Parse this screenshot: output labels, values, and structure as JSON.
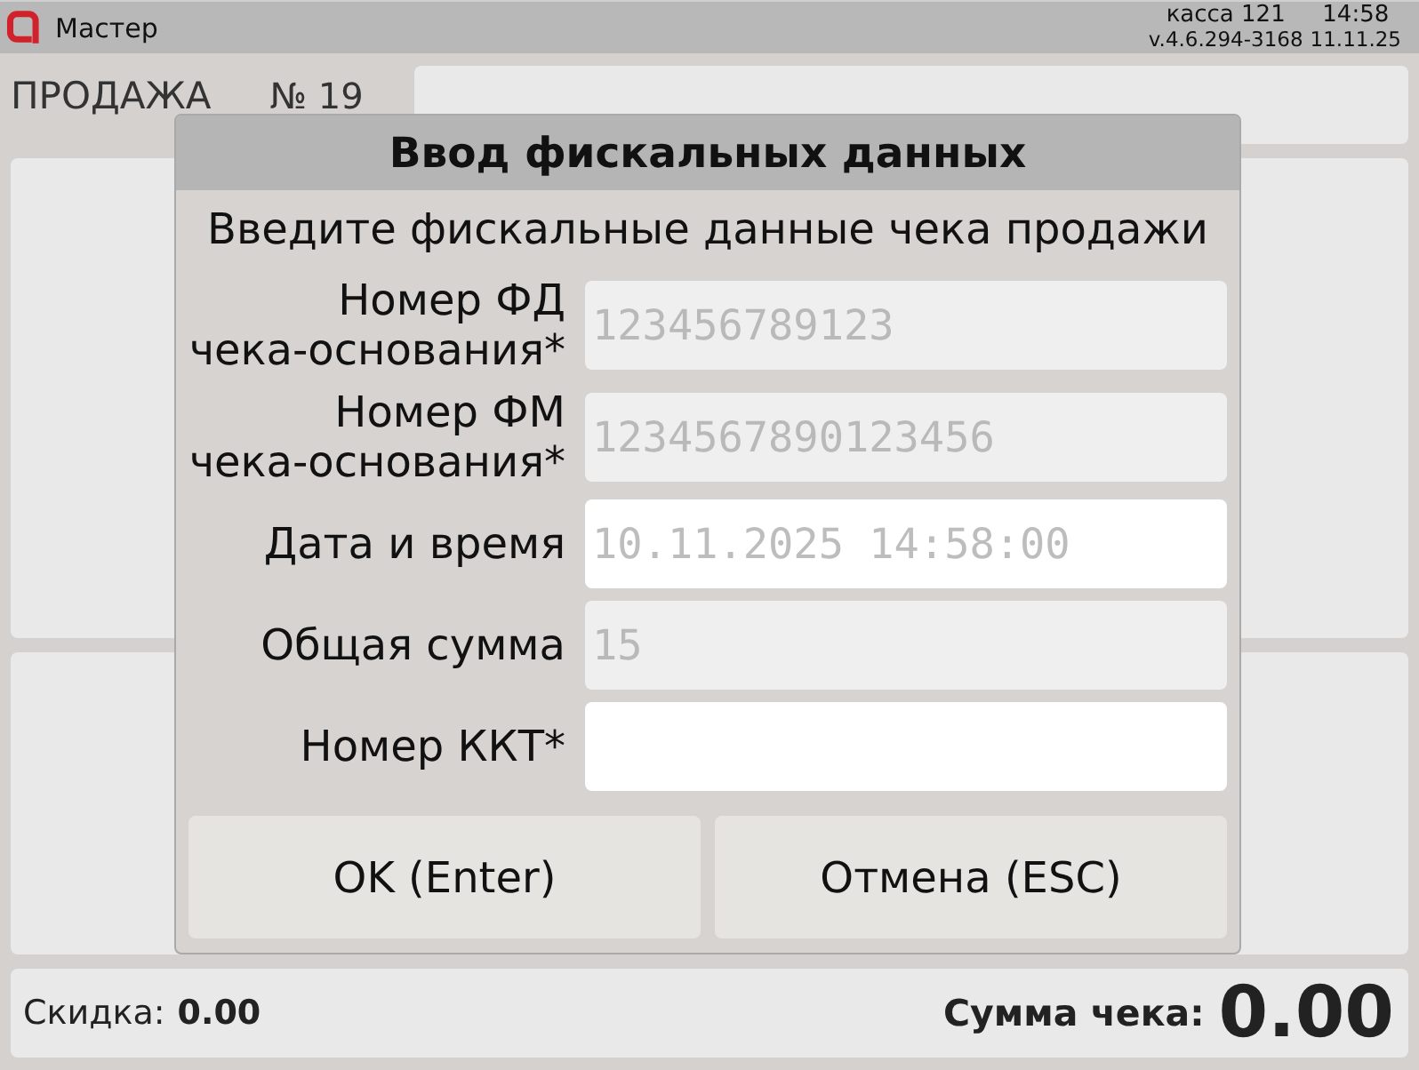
{
  "app_bar": {
    "title": "Мастер",
    "register": "касса 121",
    "time": "14:58",
    "version": "v.4.6.294-3168",
    "date": "11.11.25"
  },
  "sale": {
    "title": "ПРОДАЖА",
    "number": "№ 19"
  },
  "dialog": {
    "title": "Ввод фискальных данных",
    "prompt": "Введите фискальные данные чека продажи",
    "fields": [
      {
        "label": "Номер ФД\nчека-основания*",
        "value": "123456789123",
        "disabled": true
      },
      {
        "label": "Номер ФМ\nчека-основания*",
        "value": "1234567890123456",
        "disabled": true
      },
      {
        "label": "Дата и время",
        "placeholder": "10.11.2025 14:58:00",
        "disabled": false
      },
      {
        "label": "Общая сумма",
        "value": "15",
        "disabled": true
      },
      {
        "label": "Номер ККТ*",
        "disabled": false
      }
    ],
    "buttons": [
      "OK (Enter)",
      "Отмена (ESC)"
    ]
  },
  "footer": {
    "discount_label": "Скидка:",
    "discount": "0.00",
    "total_label": "Сумма чека:",
    "total": "0.00"
  }
}
